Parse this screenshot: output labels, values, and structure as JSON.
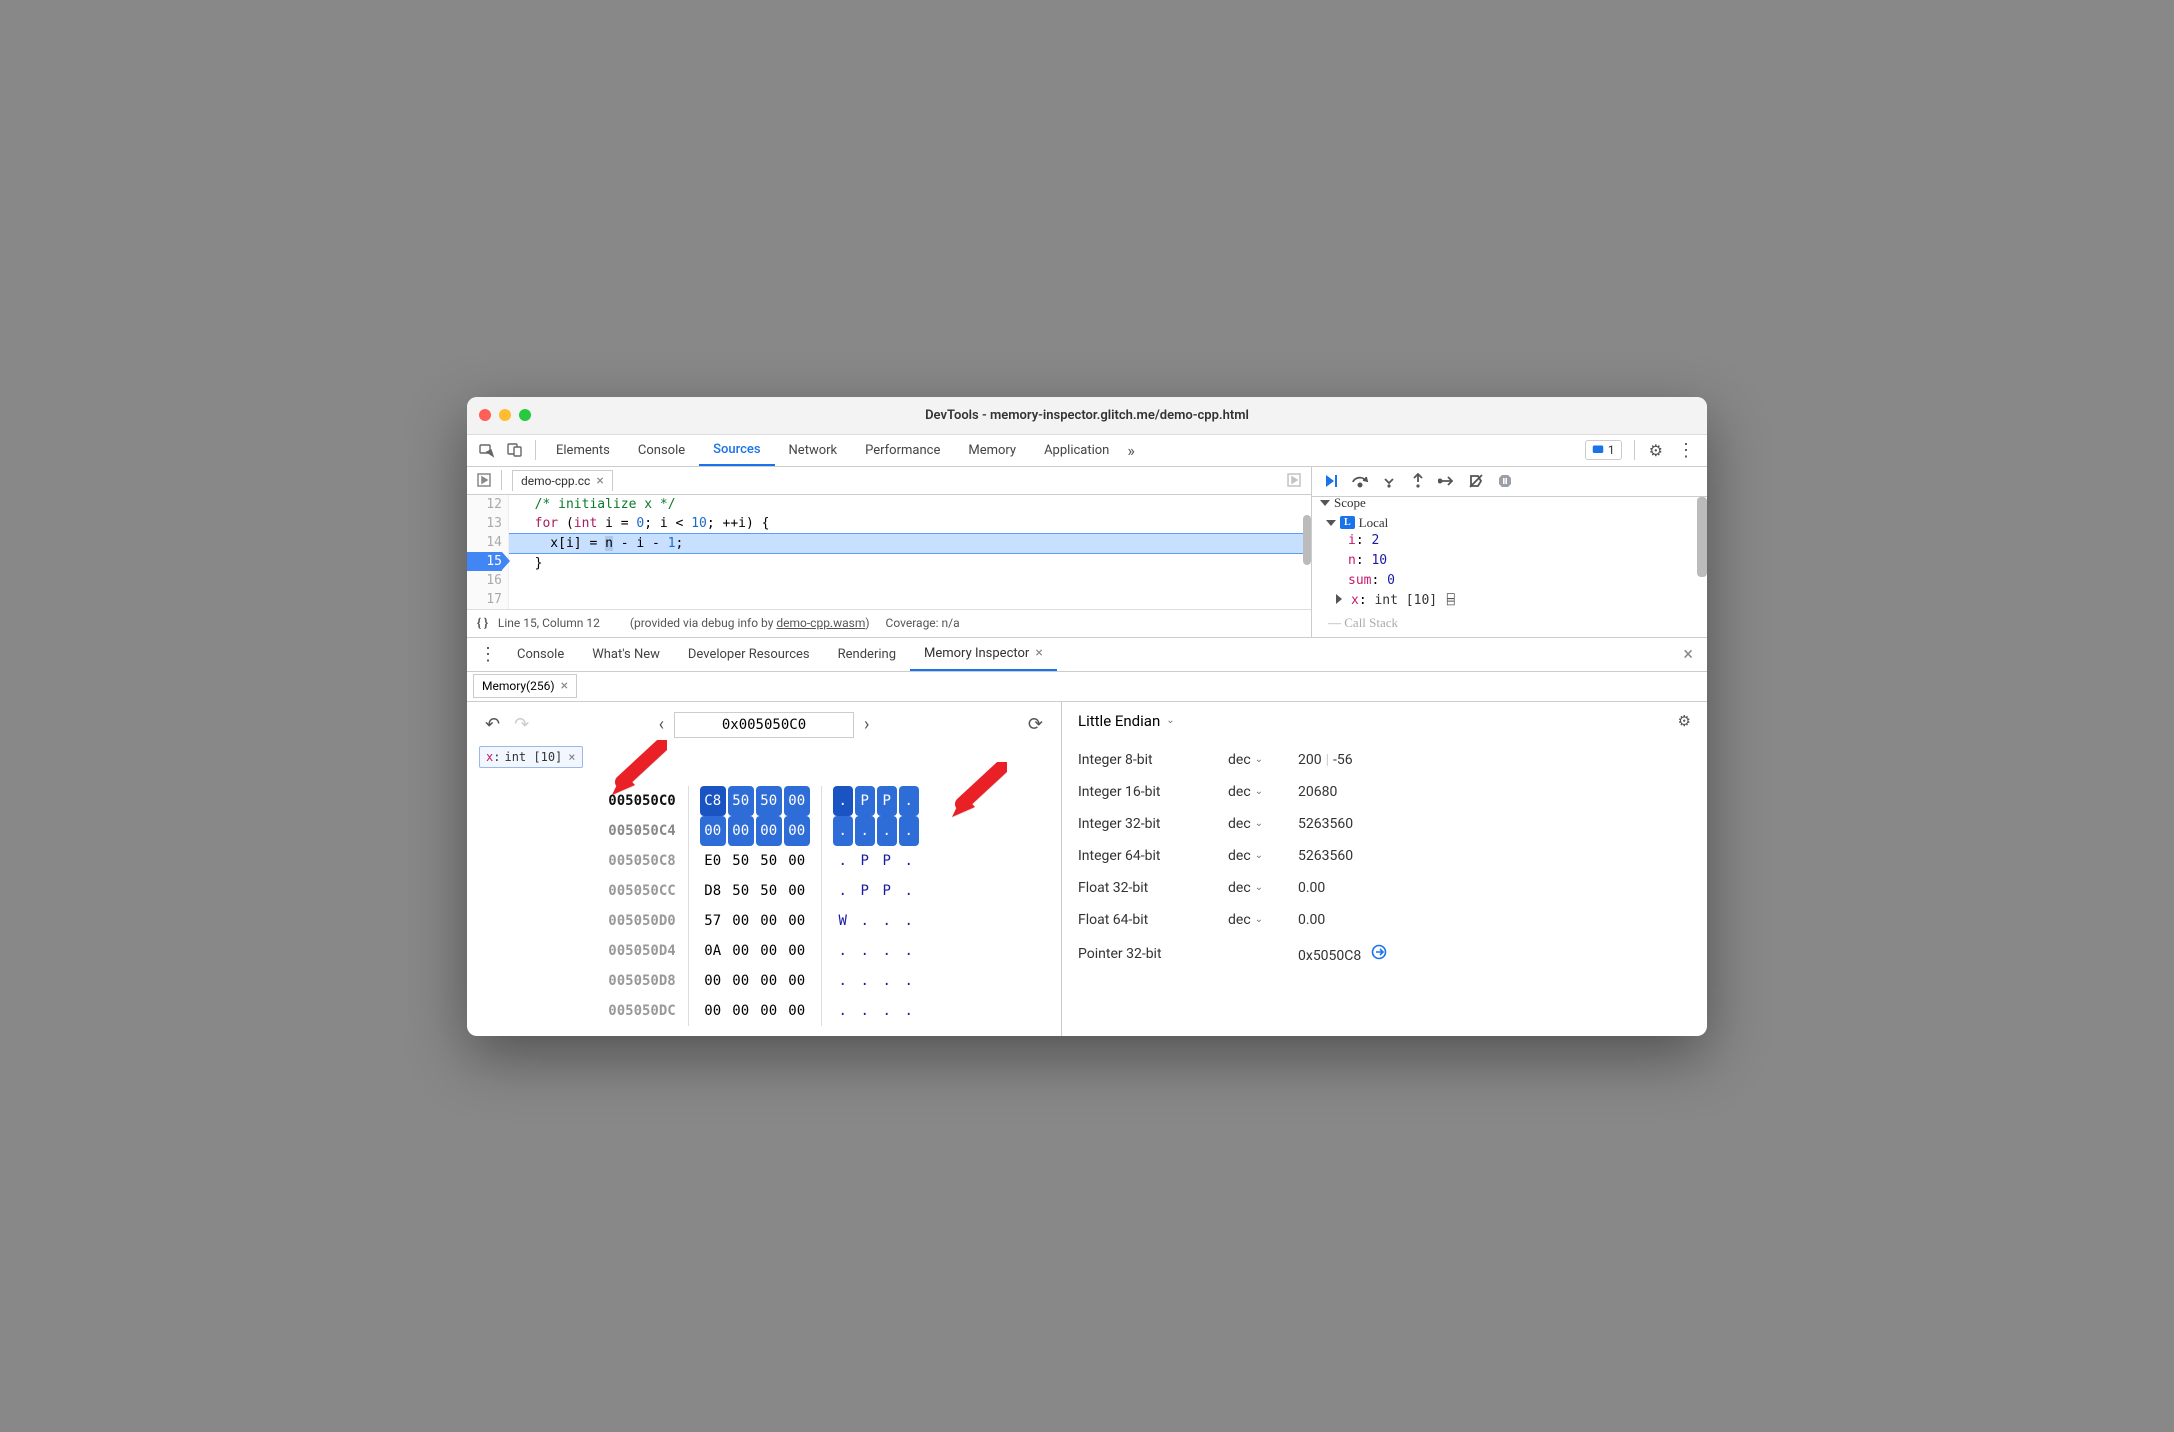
{
  "window": {
    "title": "DevTools - memory-inspector.glitch.me/demo-cpp.html"
  },
  "tabs": {
    "items": [
      "Elements",
      "Console",
      "Sources",
      "Network",
      "Performance",
      "Memory",
      "Application"
    ],
    "active": 2,
    "msg_count": "1"
  },
  "file_tab": "demo-cpp.cc",
  "code": {
    "lines": [
      {
        "n": 12,
        "t": ""
      },
      {
        "n": 13,
        "t": "  /* initialize x */"
      },
      {
        "n": 14,
        "t": "  for (int i = 0; i < 10; ++i) {"
      },
      {
        "n": 15,
        "t": "    x[i] = n - i - 1;"
      },
      {
        "n": 16,
        "t": "  }"
      },
      {
        "n": 17,
        "t": ""
      }
    ],
    "highlight": 15
  },
  "status": {
    "pos": "Line 15, Column 12",
    "provided_prefix": "(provided via debug info by ",
    "provided_link": "demo-cpp.wasm",
    "provided_suffix": ")",
    "coverage": "Coverage: n/a"
  },
  "scope": {
    "header": "Scope",
    "local": "Local",
    "vars": [
      {
        "name": "i",
        "value": "2"
      },
      {
        "name": "n",
        "value": "10"
      },
      {
        "name": "sum",
        "value": "0"
      }
    ],
    "x_name": "x",
    "x_type": "int [10]",
    "callstack": "Call Stack"
  },
  "drawer": {
    "tabs": [
      "Console",
      "What's New",
      "Developer Resources",
      "Rendering",
      "Memory Inspector"
    ],
    "active": 4
  },
  "mem_tab": "Memory(256)",
  "address": "0x005050C0",
  "chip_name": "x",
  "chip_type": "int [10]",
  "hex": {
    "rows": [
      {
        "addr": "005050C0",
        "bytes": [
          "C8",
          "50",
          "50",
          "00"
        ],
        "asc": [
          ".",
          "P",
          "P",
          "."
        ],
        "hi": true,
        "first": true
      },
      {
        "addr": "005050C4",
        "bytes": [
          "00",
          "00",
          "00",
          "00"
        ],
        "asc": [
          ".",
          ".",
          ".",
          "."
        ],
        "hi": true
      },
      {
        "addr": "005050C8",
        "bytes": [
          "E0",
          "50",
          "50",
          "00"
        ],
        "asc": [
          ".",
          "P",
          "P",
          "."
        ]
      },
      {
        "addr": "005050CC",
        "bytes": [
          "D8",
          "50",
          "50",
          "00"
        ],
        "asc": [
          ".",
          "P",
          "P",
          "."
        ]
      },
      {
        "addr": "005050D0",
        "bytes": [
          "57",
          "00",
          "00",
          "00"
        ],
        "asc": [
          "W",
          ".",
          ".",
          "."
        ]
      },
      {
        "addr": "005050D4",
        "bytes": [
          "0A",
          "00",
          "00",
          "00"
        ],
        "asc": [
          ".",
          ".",
          ".",
          "."
        ]
      },
      {
        "addr": "005050D8",
        "bytes": [
          "00",
          "00",
          "00",
          "00"
        ],
        "asc": [
          ".",
          ".",
          ".",
          "."
        ]
      },
      {
        "addr": "005050DC",
        "bytes": [
          "00",
          "00",
          "00",
          "00"
        ],
        "asc": [
          ".",
          ".",
          ".",
          "."
        ]
      }
    ]
  },
  "values": {
    "endian": "Little Endian",
    "items": [
      {
        "label": "Integer 8-bit",
        "mode": "dec",
        "value": "200",
        "value2": "-56"
      },
      {
        "label": "Integer 16-bit",
        "mode": "dec",
        "value": "20680"
      },
      {
        "label": "Integer 32-bit",
        "mode": "dec",
        "value": "5263560"
      },
      {
        "label": "Integer 64-bit",
        "mode": "dec",
        "value": "5263560"
      },
      {
        "label": "Float 32-bit",
        "mode": "dec",
        "value": "0.00"
      },
      {
        "label": "Float 64-bit",
        "mode": "dec",
        "value": "0.00"
      },
      {
        "label": "Pointer 32-bit",
        "mode": "",
        "value": "0x5050C8",
        "link": true
      }
    ]
  }
}
